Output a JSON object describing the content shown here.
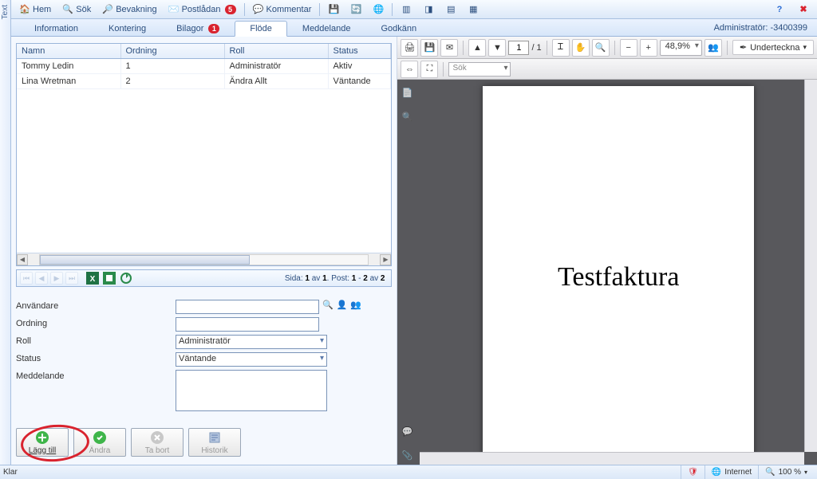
{
  "toolbar": {
    "hem": "Hem",
    "sok": "Sök",
    "bevakning": "Bevakning",
    "postladan": "Postlådan",
    "postladan_badge": "5",
    "kommentar": "Kommentar"
  },
  "tabs": {
    "information": "Information",
    "kontering": "Kontering",
    "bilagor": "Bilagor",
    "bilagor_badge": "1",
    "flode": "Flöde",
    "meddelande": "Meddelande",
    "godkann": "Godkänn"
  },
  "admin_label": "Administratör: -3400399",
  "grid": {
    "cols": {
      "namn": "Namn",
      "ordning": "Ordning",
      "roll": "Roll",
      "status": "Status"
    },
    "rows": [
      {
        "namn": "Tommy Ledin",
        "ordning": "1",
        "roll": "Administratör",
        "status": "Aktiv"
      },
      {
        "namn": "Lina Wretman",
        "ordning": "2",
        "roll": "Ändra Allt",
        "status": "Väntande"
      }
    ],
    "info_prefix": "Sida: ",
    "info_page": "1",
    "info_mid1": " av ",
    "info_total_pages": "1",
    "info_mid2": ". Post: ",
    "info_post_from": "1",
    "info_dash": " - ",
    "info_post_to": "2",
    "info_mid3": " av ",
    "info_post_total": "2"
  },
  "form": {
    "anvandare": "Användare",
    "ordning": "Ordning",
    "roll": "Roll",
    "roll_value": "Administratör",
    "status": "Status",
    "status_value": "Väntande",
    "meddelande": "Meddelande"
  },
  "actions": {
    "lagg_till": "Lägg till",
    "andra": "Ändra",
    "ta_bort": "Ta bort",
    "historik": "Historik"
  },
  "pdf": {
    "page_current": "1",
    "page_sep": " / ",
    "page_total": "1",
    "zoom": "48,9%",
    "underteckna": "Underteckna",
    "search_placeholder": "Sök",
    "doc_title": "Testfaktura"
  },
  "status": {
    "klar": "Klar",
    "internet": "Internet",
    "zoom": "100 %"
  },
  "left_rail": "Text"
}
